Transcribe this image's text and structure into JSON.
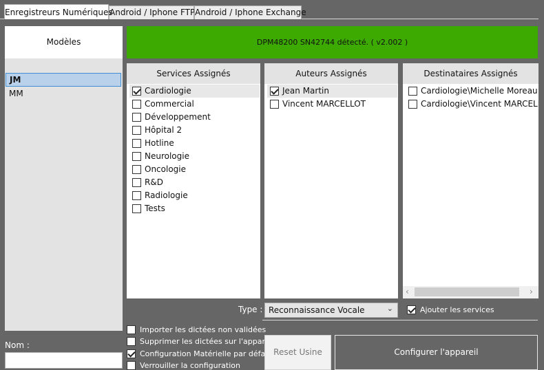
{
  "tabs": [
    "Enregistreurs Numériques",
    "Android / Iphone FTP",
    "Android / Iphone Exchange"
  ],
  "models": {
    "header": "Modèles",
    "items": [
      "JM",
      "MM"
    ]
  },
  "status": {
    "text": "DPM48200 SN42744 détecté. ( v2.002 )",
    "color": "#3caa00"
  },
  "services": {
    "header": "Services Assignés",
    "items": [
      {
        "label": "Cardiologie",
        "checked": true
      },
      {
        "label": "Commercial",
        "checked": false
      },
      {
        "label": "Développement",
        "checked": false
      },
      {
        "label": "Hôpital 2",
        "checked": false
      },
      {
        "label": "Hotline",
        "checked": false
      },
      {
        "label": "Neurologie",
        "checked": false
      },
      {
        "label": "Oncologie",
        "checked": false
      },
      {
        "label": "R&D",
        "checked": false
      },
      {
        "label": "Radiologie",
        "checked": false
      },
      {
        "label": "Tests",
        "checked": false
      }
    ]
  },
  "authors": {
    "header": "Auteurs Assignés",
    "items": [
      {
        "label": "Jean Martin",
        "checked": true
      },
      {
        "label": "Vincent MARCELLOT",
        "checked": false
      }
    ]
  },
  "recipients": {
    "header": "Destinataires Assignés",
    "items": [
      {
        "label": "Cardiologie\\Michelle Moreau",
        "checked": false
      },
      {
        "label": "Cardiologie\\Vincent MARCELLOT",
        "checked": false
      }
    ],
    "scroll_left": "‹",
    "scroll_right": "›"
  },
  "type": {
    "label": "Type :",
    "value": "Reconnaissance Vocale",
    "arrow": "⌄"
  },
  "add_services": {
    "label": "Ajouter les services",
    "checked": true
  },
  "options": [
    {
      "label": "Importer les dictées non validées",
      "checked": false
    },
    {
      "label": "Supprimer les dictées sur l'appareil",
      "checked": false
    },
    {
      "label": "Configuration Matérielle par défaut",
      "checked": true
    },
    {
      "label": "Verrouiller la configuration",
      "checked": false
    }
  ],
  "name": {
    "label": "Nom :",
    "value": ""
  },
  "buttons": {
    "reset": "Reset Usine",
    "configure": "Configurer l'appareil"
  }
}
